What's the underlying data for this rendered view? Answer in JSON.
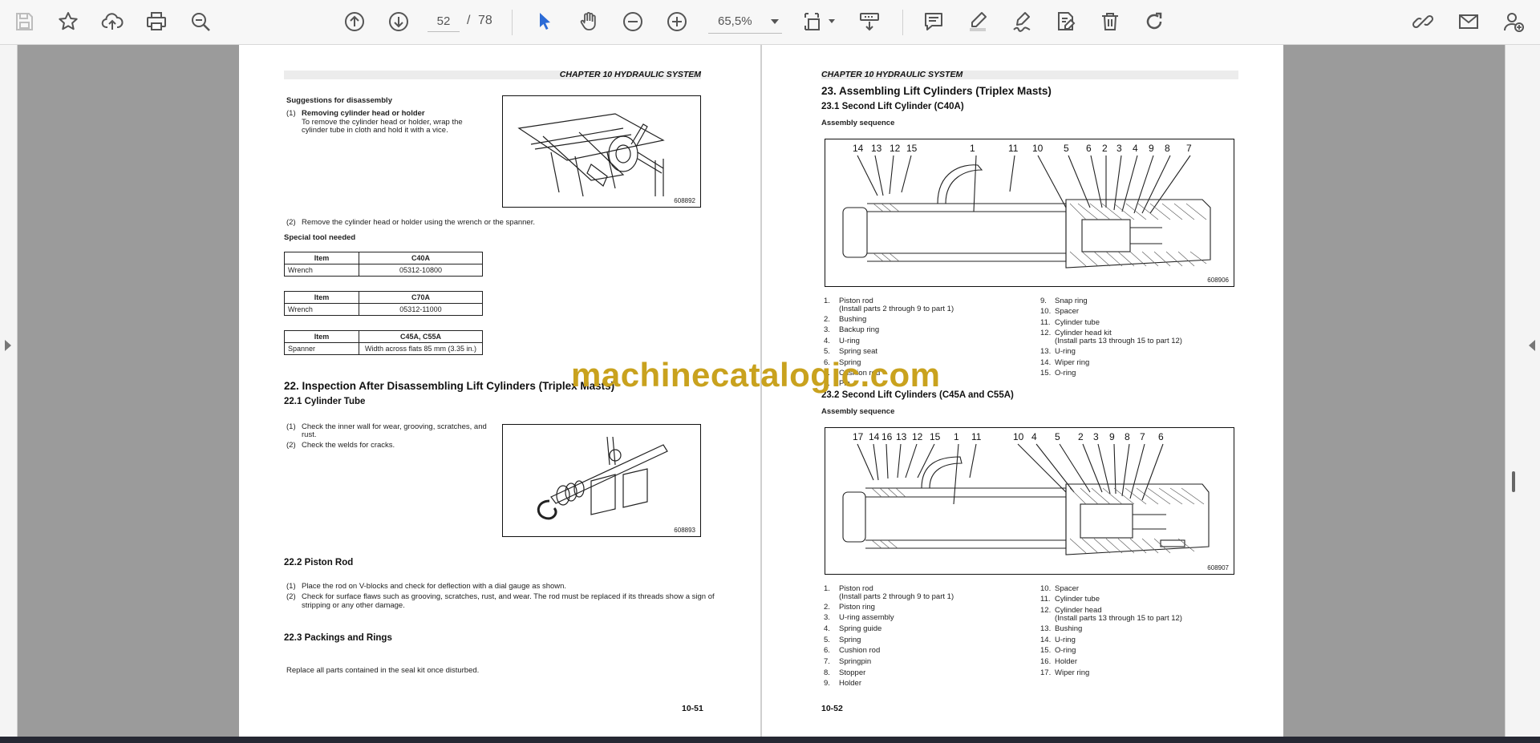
{
  "toolbar": {
    "page_current": "52",
    "page_separator": "/",
    "page_total": "78",
    "zoom": "65,5%",
    "accent": "#2c6bd6"
  },
  "icons": [
    "save-icon",
    "bookmark-star-icon",
    "upload-cloud-icon",
    "print-icon",
    "zoom-search-icon",
    "prev-page-icon",
    "next-page-icon",
    "select-cursor-icon",
    "hand-pan-icon",
    "zoom-out-icon",
    "zoom-in-icon",
    "fit-page-icon",
    "scroll-mode-icon",
    "comment-icon",
    "highlight-pen-icon",
    "sign-icon",
    "edit-pdf-icon",
    "delete-icon",
    "rotate-icon",
    "share-link-icon",
    "email-icon",
    "add-user-icon"
  ],
  "left_page": {
    "chapter": "CHAPTER 10 HYDRAULIC SYSTEM",
    "suggestions_title": "Suggestions for disassembly",
    "step1_num": "(1)",
    "step1_title": "Removing cylinder head or holder",
    "step1_line1": "To  remove  the  cylinder  head  or  holder,  wrap  the",
    "step1_line2": "cylinder tube in cloth and hold it with a vice.",
    "fig1_no": "608892",
    "step2_num": "(2)",
    "step2_text": "Remove the cylinder head or holder using the wrench or the spanner.",
    "special_tool": "Special tool needed",
    "tables": [
      {
        "h1": "Item",
        "h2": "C40A",
        "c1": "Wrench",
        "c2": "05312-10800"
      },
      {
        "h1": "Item",
        "h2": "C70A",
        "c1": "Wrench",
        "c2": "05312-11000"
      },
      {
        "h1": "Item",
        "h2": "C45A, C55A",
        "c1": "Spanner",
        "c2": "Width across flats 85 mm (3.35 in.)"
      }
    ],
    "sec22": "22.  Inspection After Disassembling Lift Cylinders (Triplex Masts)",
    "sec22_1": "22.1    Cylinder Tube",
    "s221_1_num": "(1)",
    "s221_1a": "Check the inner wall for wear, grooving, scratches, and",
    "s221_1b": "rust.",
    "s221_2_num": "(2)",
    "s221_2": "Check the welds for cracks.",
    "fig2_no": "608893",
    "sec22_2": "22.2    Piston Rod",
    "s222_1_num": "(1)",
    "s222_1": "Place the rod on V-blocks and check for deflection with a dial gauge as shown.",
    "s222_2_num": "(2)",
    "s222_2a": "Check for surface flaws such as grooving, scratches, rust, and wear. The rod must be replaced if its threads show a sign of",
    "s222_2b": "stripping or any other damage.",
    "sec22_3": "22.3    Packings and Rings",
    "s223": "Replace all parts contained in the seal kit once disturbed.",
    "page_no": "10-51"
  },
  "right_page": {
    "chapter": "CHAPTER 10 HYDRAULIC SYSTEM",
    "sec23": "23.   Assembling Lift Cylinders (Triplex Masts)",
    "sec23_1": "23.1    Second Lift Cylinder (C40A)",
    "assembly_seq_1": "Assembly sequence",
    "fig3_labels": [
      "14",
      "13",
      "12",
      "15",
      "1",
      "11",
      "10",
      "5",
      "6",
      "2",
      "3",
      "4",
      "9",
      "8",
      "7"
    ],
    "fig3_no": "608906",
    "list1_left": [
      {
        "n": "1.",
        "t": "Piston rod"
      },
      {
        "n": "",
        "t": "(Install parts 2 through 9 to part 1)"
      },
      {
        "n": "2.",
        "t": "Bushing"
      },
      {
        "n": "3.",
        "t": "Backup ring"
      },
      {
        "n": "4.",
        "t": "U-ring"
      },
      {
        "n": "5.",
        "t": "Spring seat"
      },
      {
        "n": "6.",
        "t": "Spring"
      },
      {
        "n": "7.",
        "t": "Cushion rod"
      },
      {
        "n": "8.",
        "t": "Pin"
      }
    ],
    "list1_right": [
      {
        "n": "9.",
        "t": "Snap ring"
      },
      {
        "n": "10.",
        "t": "Spacer"
      },
      {
        "n": "11.",
        "t": "Cylinder tube"
      },
      {
        "n": "12.",
        "t": "Cylinder head kit"
      },
      {
        "n": "",
        "t": "(Install parts 13 through 15 to part 12)"
      },
      {
        "n": "13.",
        "t": "U-ring"
      },
      {
        "n": "14.",
        "t": "Wiper ring"
      },
      {
        "n": "15.",
        "t": "O-ring"
      }
    ],
    "sec23_2": "23.2    Second Lift Cylinders (C45A and C55A)",
    "assembly_seq_2": "Assembly sequence",
    "fig4_labels": [
      "17",
      "14",
      "16",
      "13",
      "12",
      "15",
      "1",
      "11",
      "10",
      "4",
      "5",
      "2",
      "3",
      "9",
      "8",
      "7",
      "6"
    ],
    "fig4_no": "608907",
    "list2_left": [
      {
        "n": "1.",
        "t": "Piston rod"
      },
      {
        "n": "",
        "t": "(Install parts 2 through 9 to part 1)"
      },
      {
        "n": "2.",
        "t": "Piston ring"
      },
      {
        "n": "3.",
        "t": "U-ring assembly"
      },
      {
        "n": "4.",
        "t": "Spring guide"
      },
      {
        "n": "5.",
        "t": "Spring"
      },
      {
        "n": "6.",
        "t": "Cushion rod"
      },
      {
        "n": "7.",
        "t": "Springpin"
      },
      {
        "n": "8.",
        "t": "Stopper"
      },
      {
        "n": "9.",
        "t": "Holder"
      }
    ],
    "list2_right": [
      {
        "n": "10.",
        "t": "Spacer"
      },
      {
        "n": "11.",
        "t": "Cylinder tube"
      },
      {
        "n": "12.",
        "t": "Cylinder head"
      },
      {
        "n": "",
        "t": "(Install parts 13 through 15 to part 12)"
      },
      {
        "n": "13.",
        "t": "Bushing"
      },
      {
        "n": "14.",
        "t": "U-ring"
      },
      {
        "n": "15.",
        "t": "O-ring"
      },
      {
        "n": "16.",
        "t": "Holder"
      },
      {
        "n": "17.",
        "t": "Wiper ring"
      }
    ],
    "page_no": "10-52"
  },
  "watermark": "machinecatalogic.com"
}
